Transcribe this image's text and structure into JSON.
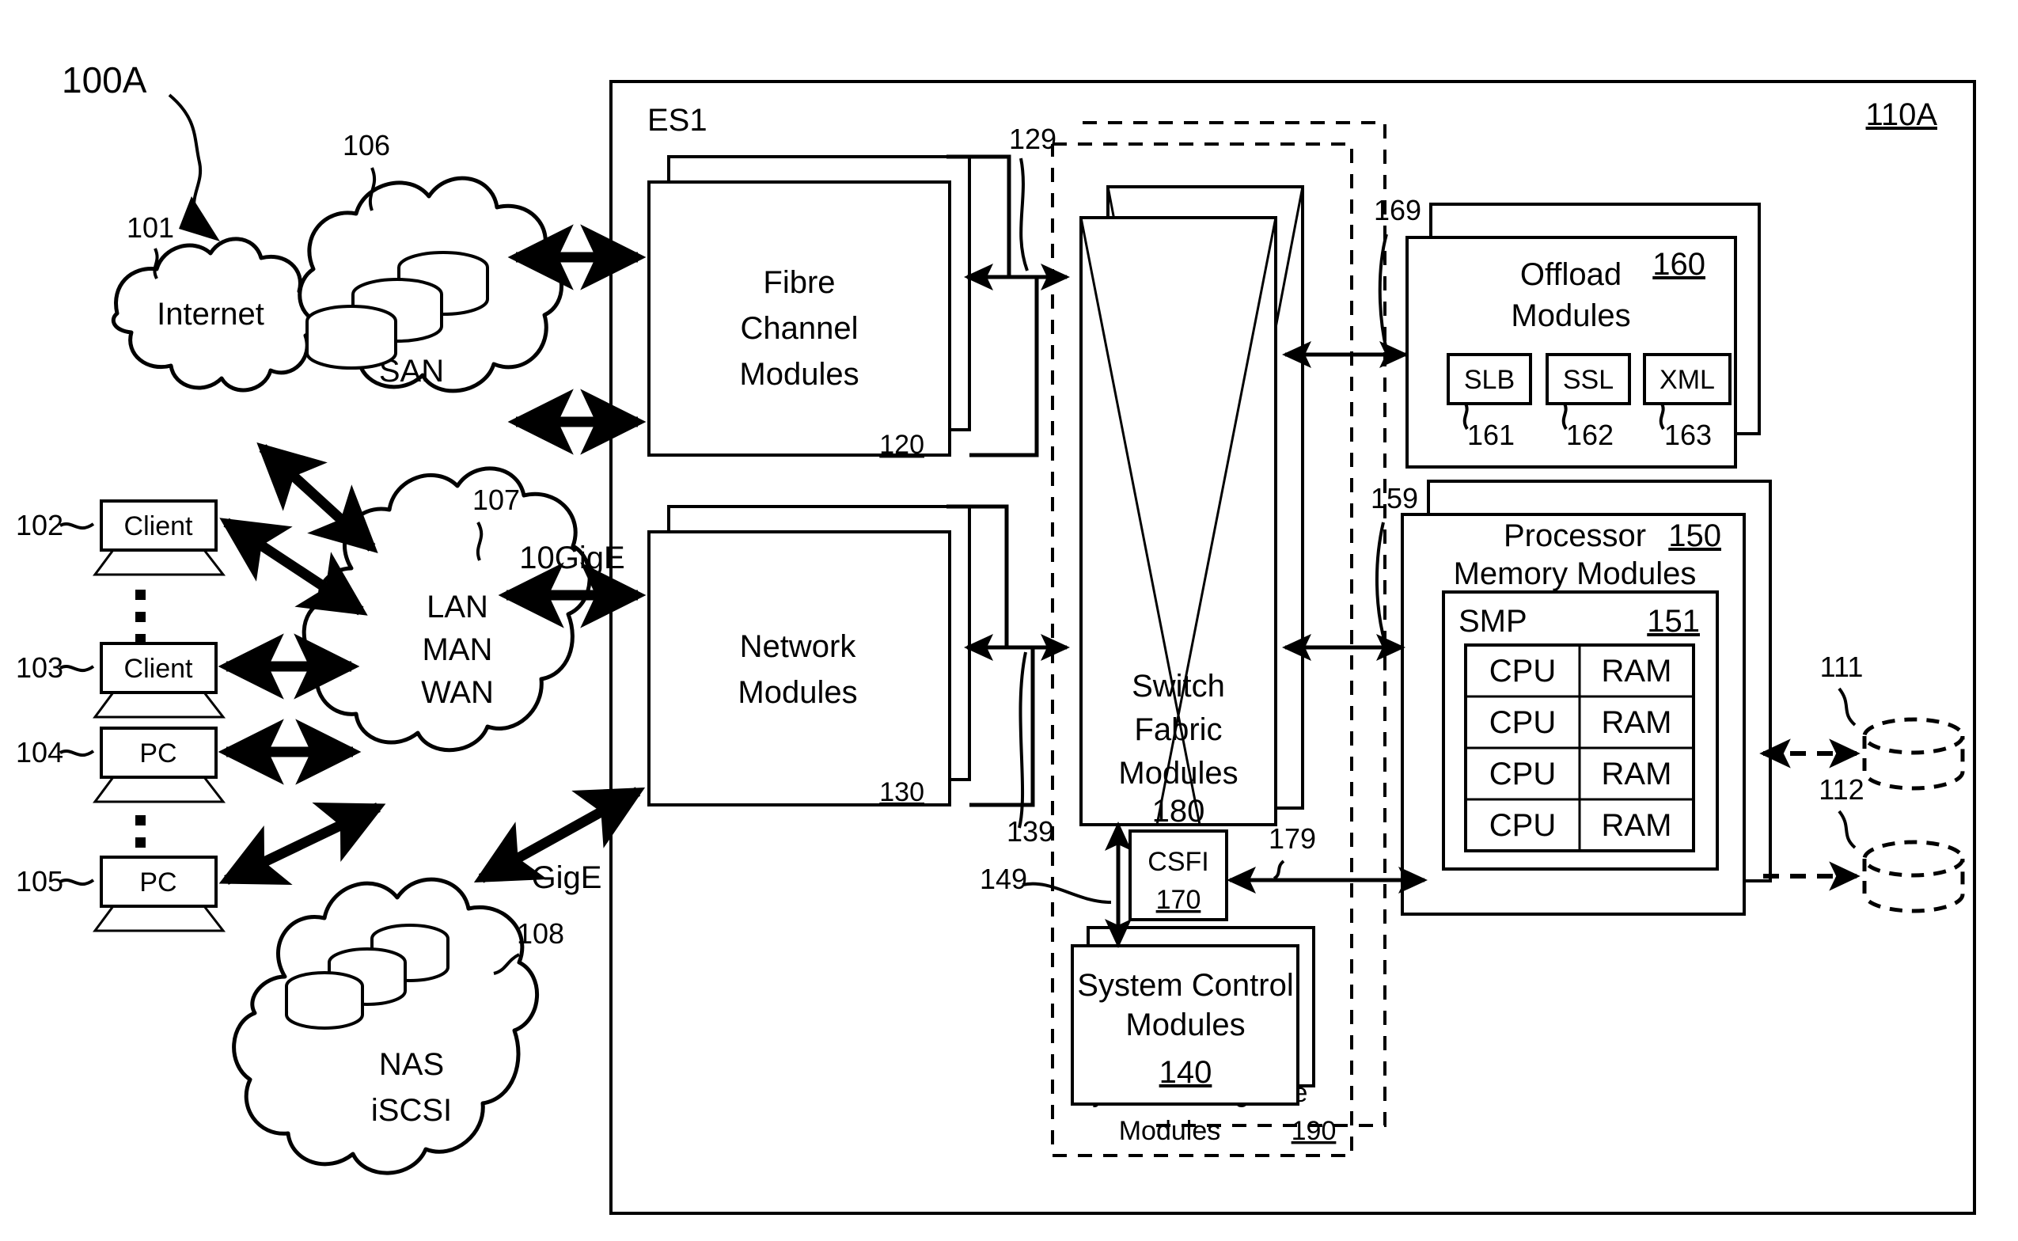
{
  "figure": {
    "id_label": "100A",
    "enclosure_label": "110A",
    "system_label": "ES1"
  },
  "external": {
    "internet": {
      "label": "Internet",
      "ref": "101"
    },
    "san": {
      "label": "SAN",
      "ref": "106"
    },
    "nas": {
      "label_line1": "NAS",
      "label_line2": "iSCSI",
      "ref": "108"
    },
    "lan": {
      "line1": "LAN",
      "line2": "MAN",
      "line3": "WAN",
      "ref": "107"
    },
    "endpoints": [
      {
        "label": "Client",
        "ref": "102",
        "type": "laptop"
      },
      {
        "label": "Client",
        "ref": "103",
        "type": "laptop"
      },
      {
        "label": "PC",
        "ref": "104",
        "type": "laptop"
      },
      {
        "label": "PC",
        "ref": "105",
        "type": "laptop"
      }
    ],
    "link_labels": {
      "tengige": "10GigE",
      "gige": "GigE"
    }
  },
  "modules": {
    "fibre_channel": {
      "line1": "Fibre",
      "line2": "Channel",
      "line3": "Modules",
      "ref": "120",
      "bus_ref": "129"
    },
    "network": {
      "line1": "Network",
      "line2": "Modules",
      "ref": "130",
      "bus_ref": "139"
    },
    "switch_fabric": {
      "line1": "Switch",
      "line2": "Fabric",
      "line3": "Modules",
      "ref": "180"
    },
    "csfi": {
      "label": "CSFI",
      "ref": "170",
      "bus_ref": "179",
      "link_ref": "149"
    },
    "system_control": {
      "line1": "System Control",
      "line2": "Modules",
      "ref": "140"
    },
    "system_intelligence": {
      "line1": "System Intelligence",
      "line2": "Modules",
      "ref": "190"
    },
    "offload": {
      "line1": "Offload",
      "line2": "Modules",
      "ref": "160",
      "bus_ref": "169",
      "sub": [
        {
          "label": "SLB",
          "ref": "161"
        },
        {
          "label": "SSL",
          "ref": "162"
        },
        {
          "label": "XML",
          "ref": "163"
        }
      ]
    },
    "processor_memory": {
      "line1": "Processor",
      "line2": "Memory Modules",
      "ref": "150",
      "bus_ref": "159",
      "smp": {
        "label": "SMP",
        "ref": "151",
        "rows": [
          {
            "cpu": "CPU",
            "ram": "RAM"
          },
          {
            "cpu": "CPU",
            "ram": "RAM"
          },
          {
            "cpu": "CPU",
            "ram": "RAM"
          },
          {
            "cpu": "CPU",
            "ram": "RAM"
          }
        ]
      }
    }
  },
  "storage_refs": [
    {
      "ref": "111"
    },
    {
      "ref": "112"
    }
  ],
  "colors": {
    "stroke": "#000000",
    "fill": "#ffffff"
  }
}
